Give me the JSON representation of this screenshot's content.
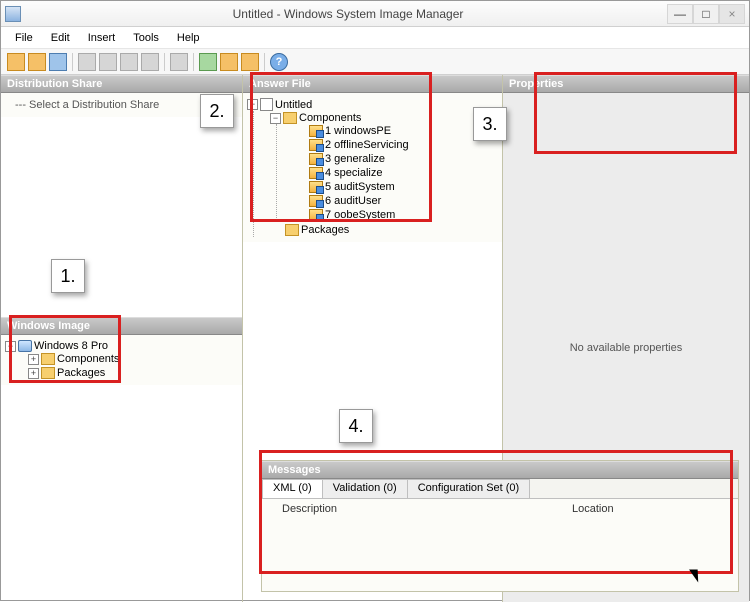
{
  "window": {
    "title": "Untitled - Windows System Image Manager",
    "min": "—",
    "max": "□",
    "close": "×"
  },
  "menu": {
    "file": "File",
    "edit": "Edit",
    "insert": "Insert",
    "tools": "Tools",
    "help": "Help"
  },
  "panels": {
    "distShare": "Distribution Share",
    "distSharePlaceholder": "Select a Distribution Share",
    "windowsImage": "Windows Image",
    "answerFile": "Answer File",
    "properties": "Properties",
    "messages": "Messages",
    "noProps": "No available properties"
  },
  "windowsImageTree": {
    "root": "Windows 8 Pro",
    "components": "Components",
    "packages": "Packages"
  },
  "answerTree": {
    "root": "Untitled",
    "components": "Components",
    "passes": {
      "p1": "1 windowsPE",
      "p2": "2 offlineServicing",
      "p3": "3 generalize",
      "p4": "4 specialize",
      "p5": "5 auditSystem",
      "p6": "6 auditUser",
      "p7": "7 oobeSystem"
    },
    "packages": "Packages"
  },
  "messages": {
    "tabXml": "XML (0)",
    "tabValidation": "Validation (0)",
    "tabConfig": "Configuration Set (0)",
    "colDesc": "Description",
    "colLoc": "Location"
  },
  "annotations": {
    "n1": "1.",
    "n2": "2.",
    "n3": "3.",
    "n4": "4."
  }
}
